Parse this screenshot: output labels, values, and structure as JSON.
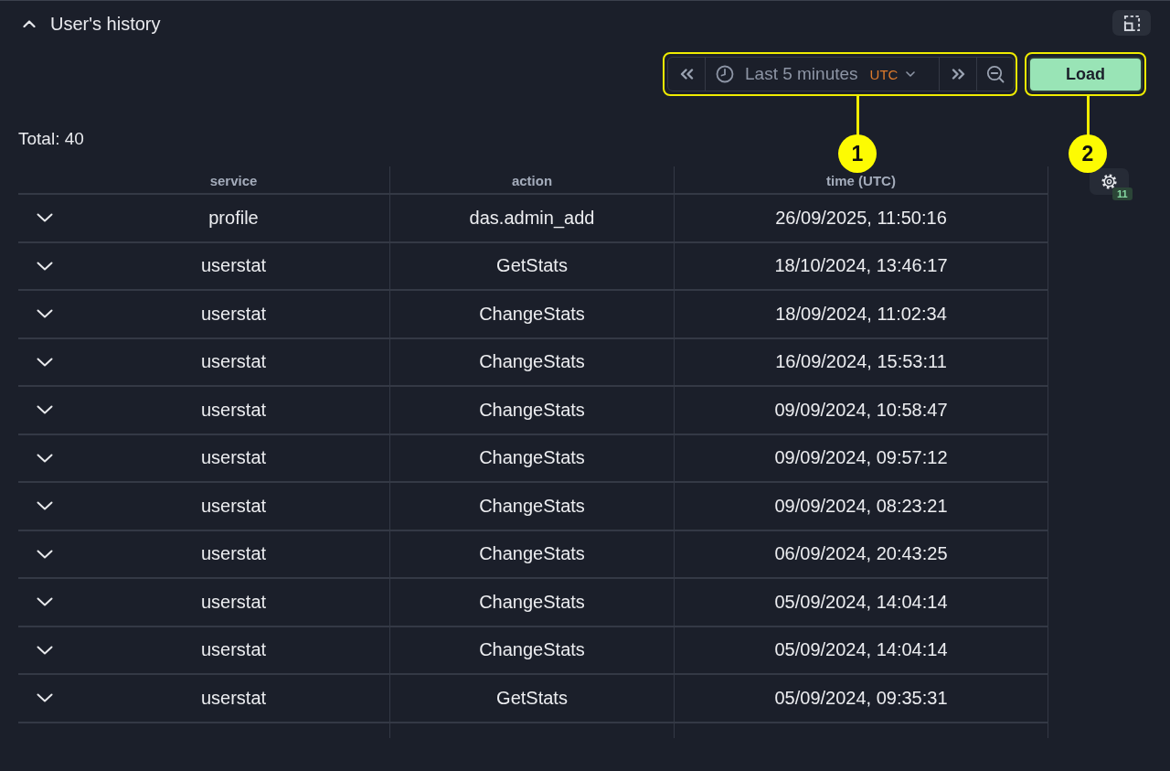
{
  "panel": {
    "title": "User's history",
    "expanded": true
  },
  "toolbar": {
    "time_range": {
      "label": "Last 5 minutes",
      "timezone": "UTC",
      "callout": "1"
    },
    "load_button": {
      "label": "Load",
      "callout": "2"
    }
  },
  "total": "Total: 40",
  "table": {
    "columns": [
      "service",
      "action",
      "time (UTC)"
    ],
    "rows": [
      {
        "service": "profile",
        "action": "das.admin_add",
        "time": "26/09/2025, 11:50:16",
        "expanded": false
      },
      {
        "service": "userstat",
        "action": "GetStats",
        "time": "18/10/2024, 13:46:17",
        "expanded": false
      },
      {
        "service": "userstat",
        "action": "ChangeStats",
        "time": "18/09/2024, 11:02:34",
        "expanded": false
      },
      {
        "service": "userstat",
        "action": "ChangeStats",
        "time": "16/09/2024, 15:53:11",
        "expanded": false
      },
      {
        "service": "userstat",
        "action": "ChangeStats",
        "time": "09/09/2024, 10:58:47",
        "expanded": false
      },
      {
        "service": "userstat",
        "action": "ChangeStats",
        "time": "09/09/2024, 09:57:12",
        "expanded": false
      },
      {
        "service": "userstat",
        "action": "ChangeStats",
        "time": "09/09/2024, 08:23:21",
        "expanded": false
      },
      {
        "service": "userstat",
        "action": "ChangeStats",
        "time": "06/09/2024, 20:43:25",
        "expanded": false
      },
      {
        "service": "userstat",
        "action": "ChangeStats",
        "time": "05/09/2024, 14:04:14",
        "expanded": false
      },
      {
        "service": "userstat",
        "action": "ChangeStats",
        "time": "05/09/2024, 14:04:14",
        "expanded": false
      },
      {
        "service": "userstat",
        "action": "GetStats",
        "time": "05/09/2024, 09:35:31",
        "expanded": false
      }
    ],
    "settings_badge": "11"
  }
}
